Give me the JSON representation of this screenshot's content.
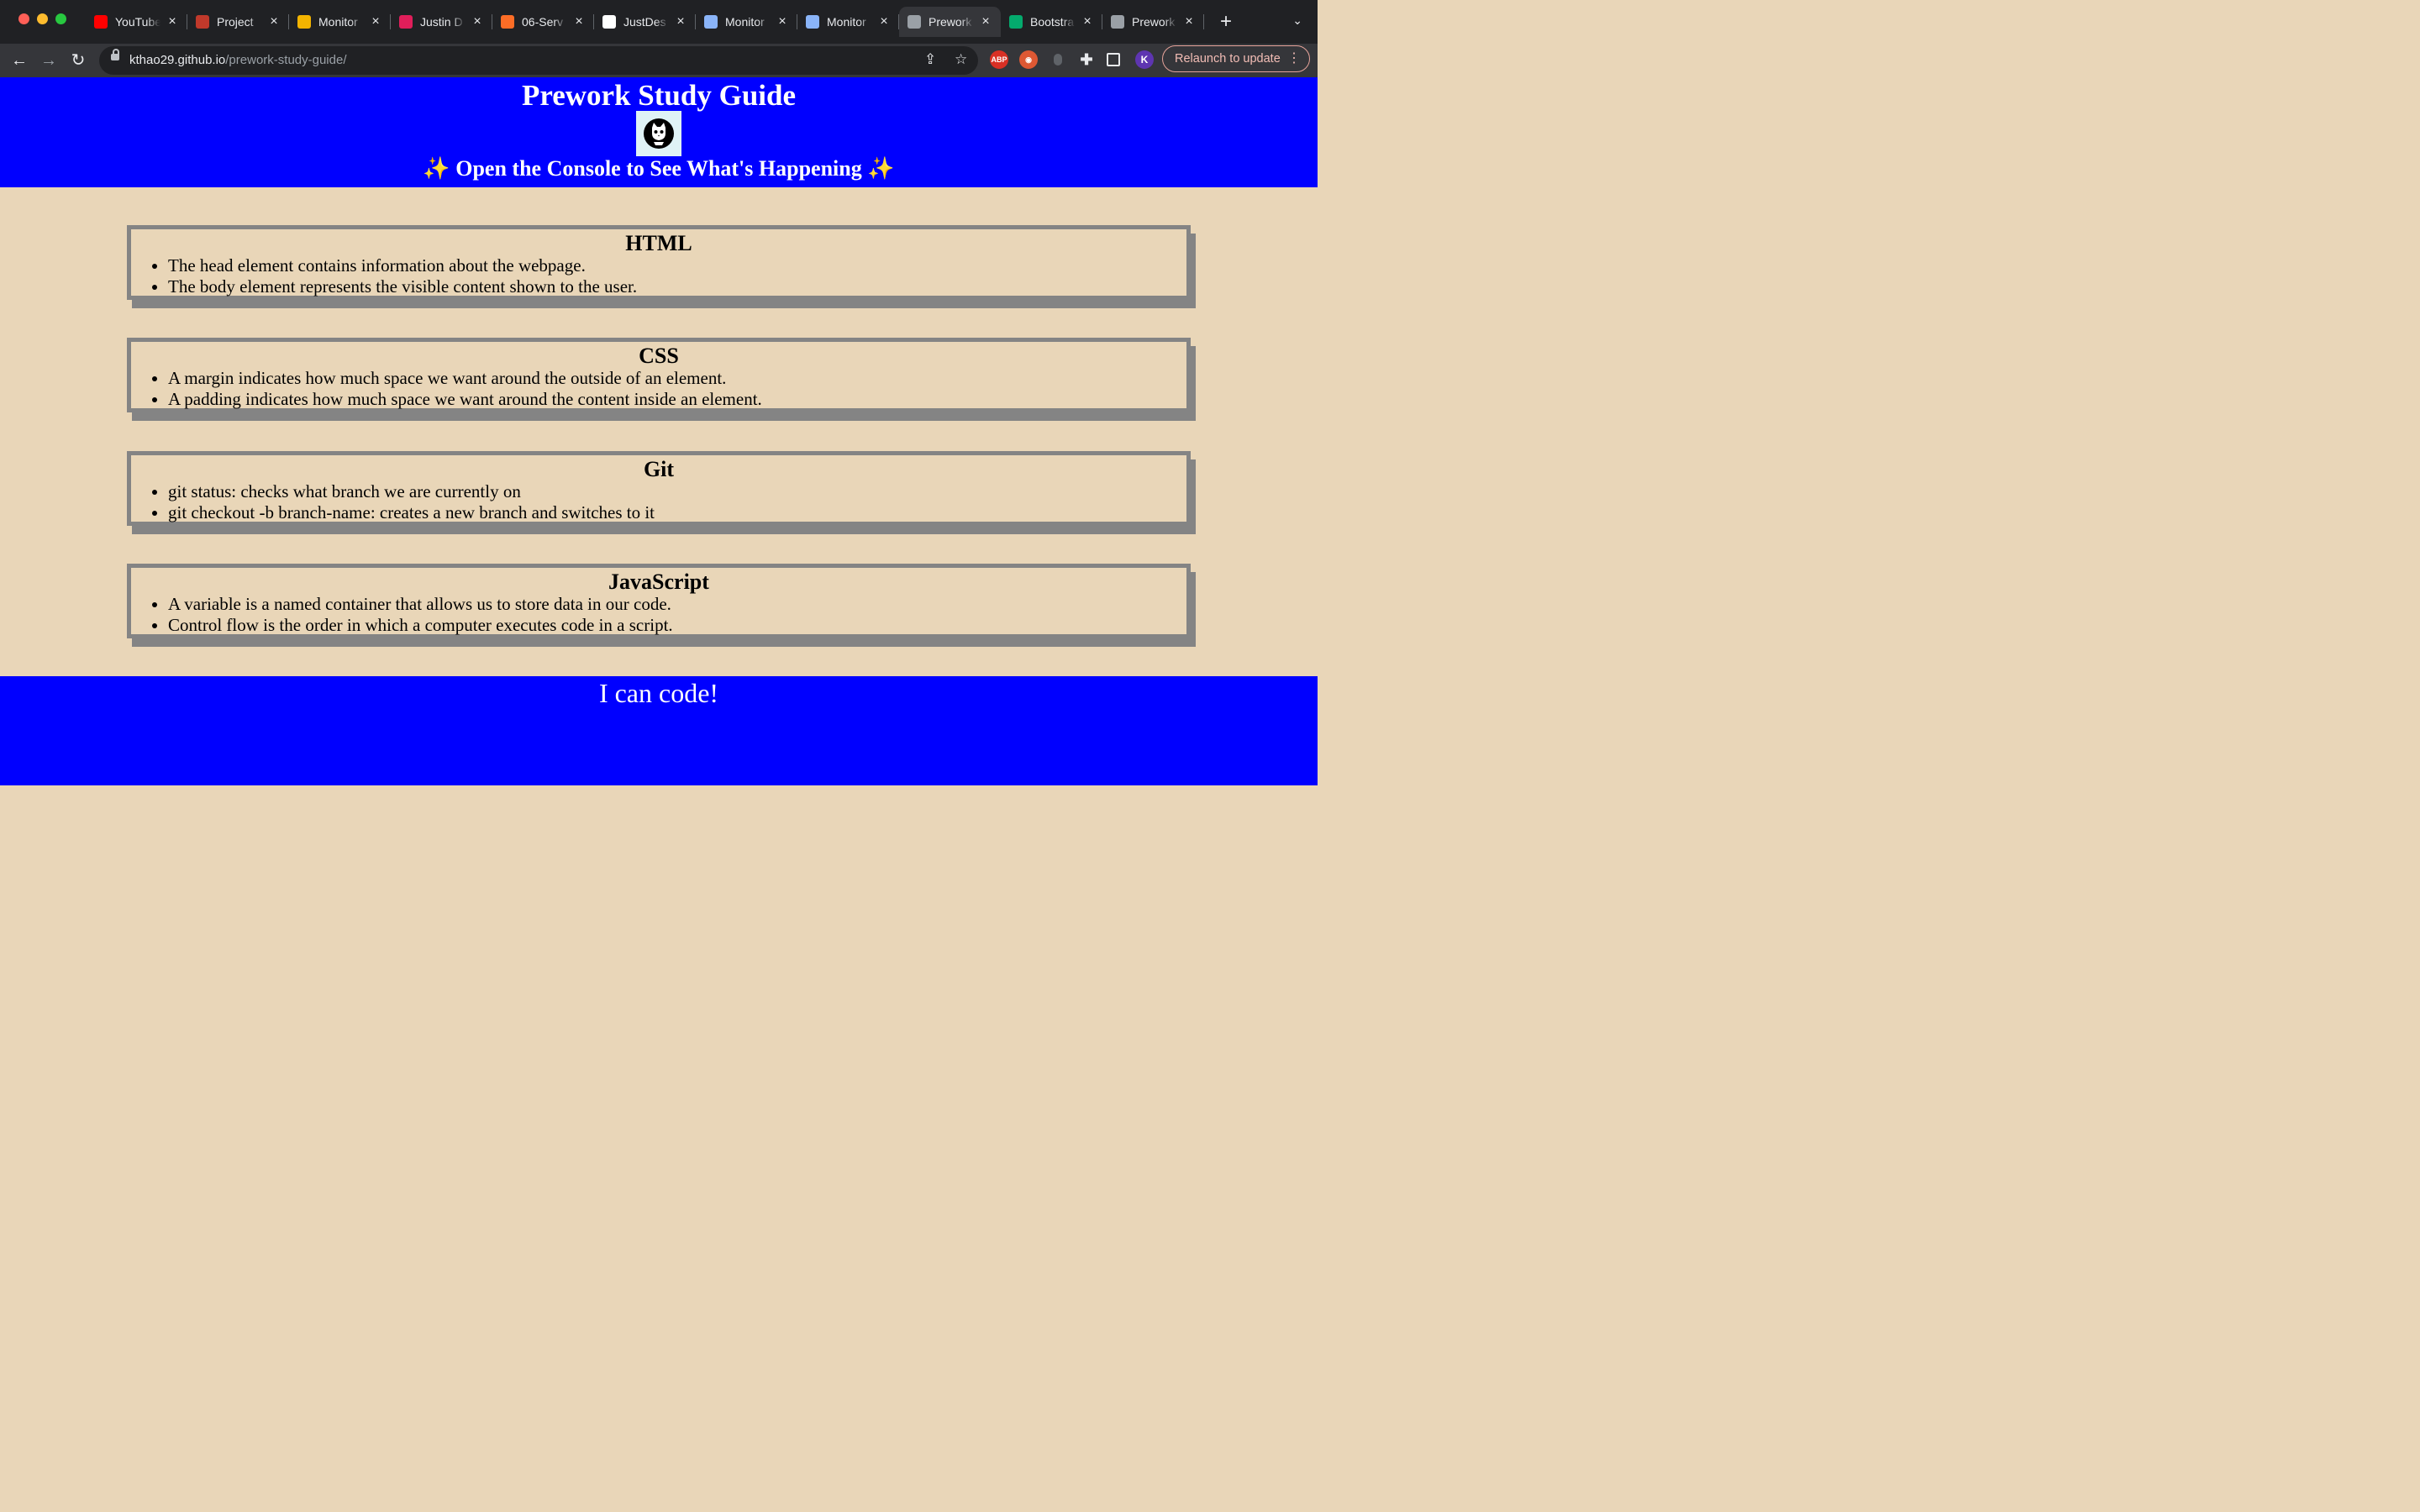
{
  "browser": {
    "tabs": [
      {
        "label": "YouTube",
        "icon": "youtube-icon",
        "color": "#ff0000"
      },
      {
        "label": "Project",
        "icon": "project-icon",
        "color": "#c0392b"
      },
      {
        "label": "Monitor",
        "icon": "slides-icon",
        "color": "#f4b400"
      },
      {
        "label": "Justin D",
        "icon": "slack-icon",
        "color": "#e01e5a"
      },
      {
        "label": "06-Serv",
        "icon": "gitlab-icon",
        "color": "#fc6d26"
      },
      {
        "label": "JustDes",
        "icon": "github-icon",
        "color": "#ffffff"
      },
      {
        "label": "Monitor",
        "icon": "monitor-icon",
        "color": "#8ab4f8"
      },
      {
        "label": "Monitor",
        "icon": "monitor-icon",
        "color": "#8ab4f8"
      },
      {
        "label": "Prework",
        "icon": "globe-icon",
        "color": "#9aa0a6",
        "active": true
      },
      {
        "label": "Bootstra",
        "icon": "w3schools-icon",
        "color": "#04aa6d"
      },
      {
        "label": "Prework",
        "icon": "globe-icon",
        "color": "#9aa0a6"
      }
    ],
    "url_host": "kthao29.github.io",
    "url_path": "/prework-study-guide/",
    "relaunch_label": "Relaunch to update",
    "profile_initial": "K"
  },
  "header": {
    "title": "Prework Study Guide",
    "subtitle": "Open the Console to See What's Happening",
    "sparkle": "✨"
  },
  "sections": [
    {
      "title": "HTML",
      "items": [
        "The head element contains information about the webpage.",
        "The body element represents the visible content shown to the user."
      ]
    },
    {
      "title": "CSS",
      "items": [
        "A margin indicates how much space we want around the outside of an element.",
        "A padding indicates how much space we want around the content inside an element."
      ]
    },
    {
      "title": "Git",
      "items": [
        "git status: checks what branch we are currently on",
        "git checkout -b branch-name: creates a new branch and switches to it"
      ]
    },
    {
      "title": "JavaScript",
      "items": [
        "A variable is a named container that allows us to store data in our code.",
        "Control flow is the order in which a computer executes code in a script."
      ]
    }
  ],
  "footer": {
    "text": "I can code!"
  },
  "colors": {
    "header_bg": "#0000ff",
    "page_bg": "#e9d6b8",
    "card_border": "#848484"
  }
}
